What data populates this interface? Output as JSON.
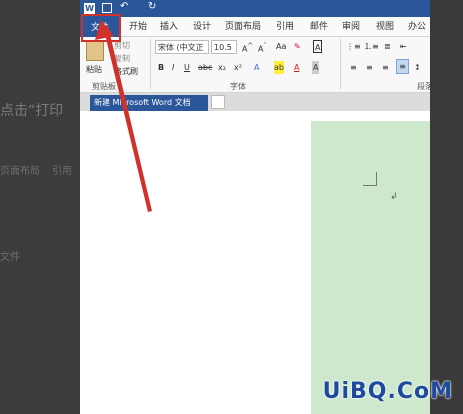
{
  "background": {
    "left_text_1": "点击“打印",
    "left_text_2": "文件",
    "left_tab_1": "页面布局",
    "left_tab_2": "引用"
  },
  "window": {
    "tabs": [
      {
        "label": "文件"
      },
      {
        "label": "开始"
      },
      {
        "label": "插入"
      },
      {
        "label": "设计"
      },
      {
        "label": "页面布局"
      },
      {
        "label": "引用"
      },
      {
        "label": "邮件"
      },
      {
        "label": "审阅"
      },
      {
        "label": "视图"
      },
      {
        "label": "办公"
      }
    ]
  },
  "ribbon": {
    "paste_label": "粘贴",
    "cut_label": "剪切",
    "copy_label": "复制",
    "format_painter_label": "格式刷",
    "clipboard_group": "剪贴板",
    "font_name": "宋体 (中文正",
    "font_size": "10.5",
    "bold": "B",
    "italic": "I",
    "underline": "U",
    "strikethrough": "abc",
    "subscript": "x₂",
    "superscript": "x²",
    "font_group": "字体",
    "paragraph_group": "段落"
  },
  "document": {
    "tab_title": "新建 Microsoft Word 文档",
    "close_glyph": "×"
  },
  "watermark": "UiBQ.CoM",
  "colors": {
    "accent": "#2b579a",
    "highlight": "#d0322b",
    "page_green": "#cde8cd"
  }
}
